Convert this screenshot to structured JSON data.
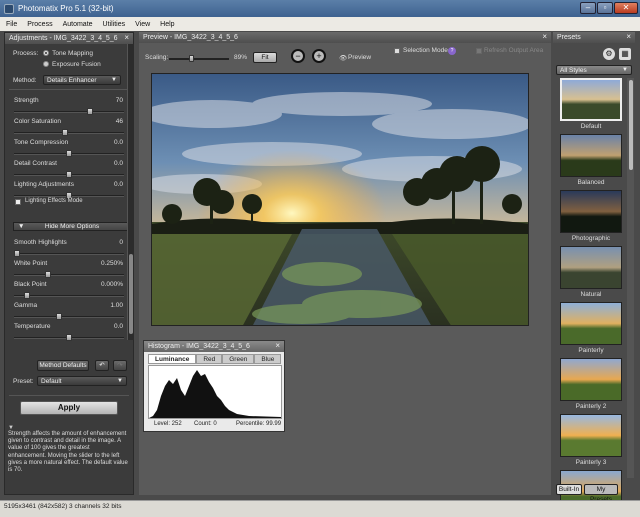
{
  "window": {
    "title": "Photomatix Pro 5.1 (32-bit)",
    "min": "–",
    "max": "▫",
    "close": "✕"
  },
  "menu": [
    "File",
    "Process",
    "Automate",
    "Utilities",
    "View",
    "Help"
  ],
  "adjustments": {
    "header": "Adjustments - IMG_3422_3_4_5_6",
    "process_label": "Process:",
    "process_opt1": "Tone Mapping",
    "process_opt2": "Exposure Fusion",
    "method_label": "Method:",
    "method_value": "Details Enhancer",
    "sliders": [
      {
        "label": "Strength",
        "value": "70",
        "pos": 0.7
      },
      {
        "label": "Color Saturation",
        "value": "46",
        "pos": 0.46
      },
      {
        "label": "Tone Compression",
        "value": "0.0",
        "pos": 0.5
      },
      {
        "label": "Detail Contrast",
        "value": "0.0",
        "pos": 0.5
      },
      {
        "label": "Lighting Adjustments",
        "value": "0.0",
        "pos": 0.5
      }
    ],
    "lighting_effects": "Lighting Effects Mode",
    "more_options": "Hide More Options",
    "more_sliders": [
      {
        "label": "Smooth Highlights",
        "value": "0",
        "pos": 0.0
      },
      {
        "label": "White Point",
        "value": "0.250%",
        "pos": 0.3
      },
      {
        "label": "Black Point",
        "value": "0.000%",
        "pos": 0.1
      },
      {
        "label": "Gamma",
        "value": "1.00",
        "pos": 0.4
      },
      {
        "label": "Temperature",
        "value": "0.0",
        "pos": 0.5
      }
    ],
    "method_defaults": "Method Defaults",
    "preset_label": "Preset:",
    "preset_value": "Default",
    "apply": "Apply",
    "description": "Strength affects the amount of enhancement given to contrast and detail in the image. A value of 100 gives the greatest enhancement. Moving the slider to the left gives a more natural effect. The default value is 70."
  },
  "preview": {
    "header": "Preview - IMG_3422_3_4_5_6",
    "scaling_label": "Scaling:",
    "scaling_value": "89%",
    "fit": "Fit",
    "preview_label": "Preview",
    "selection_mode": "Selection Mode",
    "refresh": "Refresh Output Area"
  },
  "histogram": {
    "header": "Histogram - IMG_3422_3_4_5_6",
    "tabs": [
      "Luminance",
      "Red",
      "Green",
      "Blue"
    ],
    "level": "Level: 252",
    "count": "Count: 0",
    "percentile": "Percentile: 99.99"
  },
  "presets": {
    "header": "Presets",
    "filter": "All Styles",
    "items": [
      "Default",
      "Balanced",
      "Photographic",
      "Natural",
      "Painterly",
      "Painterly 2",
      "Painterly 3",
      ""
    ],
    "tab_builtin": "Built-In",
    "tab_mine": "My Presets"
  },
  "status": "5195x3461 (842x582) 3 channels 32 bits"
}
